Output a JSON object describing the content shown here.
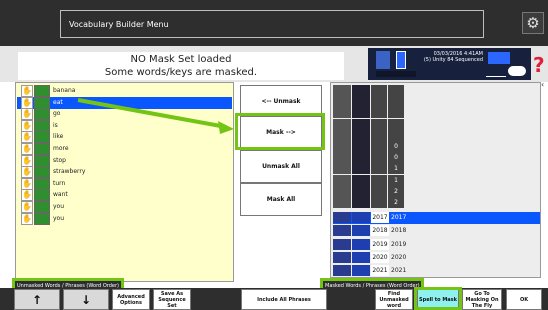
{
  "header": {
    "title": "Vocabulary Builder Menu",
    "settings_icon": "gear-icon"
  },
  "message": {
    "line1": "NO Mask Set loaded",
    "line2": "Some words/keys are masked."
  },
  "device": {
    "datetime": "03/03/2016 4:41AM",
    "vocab": "(5) Unity 84 Sequenced",
    "help": "?"
  },
  "colors": {
    "accent_green": "#74c414",
    "selection_blue": "#0a57ff",
    "word_list_bg": "#ffffcc"
  },
  "left_list": {
    "items": [
      "banana",
      "eat",
      "go",
      "is",
      "like",
      "more",
      "stop",
      "strawberry",
      "turn",
      "want",
      "you",
      "you"
    ],
    "selected_index": 1,
    "label": "Unmasked Words / Phrases (Word Order)"
  },
  "mid_buttons": {
    "unmask": "<-- Unmask",
    "mask": "Mask -->",
    "unmask_all": "Unmask All",
    "mask_all": "Mask All"
  },
  "right_list": {
    "rows": [
      {
        "a": "",
        "b": ""
      },
      {
        "a": "",
        "b": ""
      },
      {
        "a": "",
        "b": ""
      },
      {
        "a": "",
        "b": ""
      },
      {
        "a": "",
        "b": ""
      },
      {
        "a": "",
        "b": "0"
      },
      {
        "a": "",
        "b": "0"
      },
      {
        "a": "",
        "b": "1"
      },
      {
        "a": "",
        "b": "1"
      },
      {
        "a": "",
        "b": "2"
      },
      {
        "a": "",
        "b": "2"
      }
    ],
    "years": [
      {
        "num": "2017",
        "label": "2017"
      },
      {
        "num": "2018",
        "label": "2018"
      },
      {
        "num": "2019",
        "label": "2019"
      },
      {
        "num": "2020",
        "label": "2020"
      },
      {
        "num": "2021",
        "label": "2021"
      }
    ],
    "selected_year_index": 0,
    "label": "Masked Words / Phrases (Word Order)"
  },
  "footer": {
    "up_icon": "↑",
    "down_icon": "↓",
    "advanced": "Advanced Options",
    "save": "Save As Sequence Set",
    "include_all": "Include All Phrases",
    "find": "Find Unmasked word",
    "spell": "Spell to Mask",
    "go_masking": "Go To Masking On The Fly",
    "ok": "OK"
  }
}
